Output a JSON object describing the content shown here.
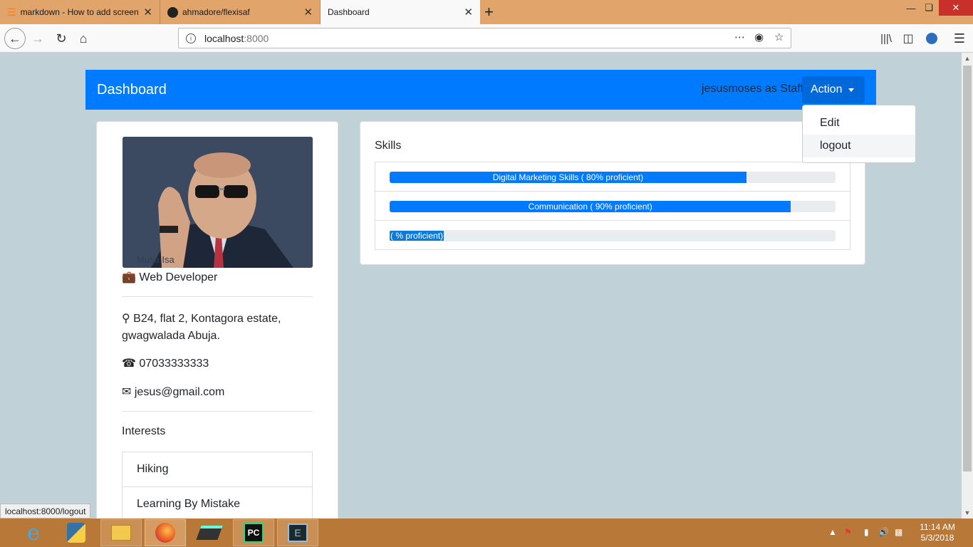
{
  "browser": {
    "tabs": [
      {
        "title": "markdown - How to add screen",
        "icon": "stackoverflow-icon"
      },
      {
        "title": "ahmadore/flexisaf",
        "icon": "github-icon"
      },
      {
        "title": "Dashboard",
        "icon": "",
        "active": true
      }
    ],
    "url_host": "localhost",
    "url_port": ":8000",
    "status_url": "localhost:8000/logout"
  },
  "navbar": {
    "brand": "Dashboard",
    "user_label": "jesusmoses as Staff",
    "action_label": "Action",
    "menu": [
      "Edit",
      "logout"
    ]
  },
  "profile": {
    "photo_caption": "Musa Isa",
    "job": "Web Developer",
    "address": "B24, flat 2, Kontagora estate, gwagwalada Abuja.",
    "phone": "07033333333",
    "email": "jesus@gmail.com",
    "interests_title": "Interests",
    "interests": [
      "Hiking",
      "Learning By Mistake"
    ]
  },
  "skills": {
    "title": "Skills",
    "items": [
      {
        "label": "Digital Marketing Skills ( 80% proficient)",
        "percent": 80
      },
      {
        "label": "Communication ( 90% proficient)",
        "percent": 90
      },
      {
        "label": "( % proficient)",
        "percent": 0
      }
    ]
  },
  "taskbar": {
    "apps": [
      "internet-explorer-icon",
      "python-icon",
      "file-explorer-icon",
      "firefox-icon",
      "scanner-icon",
      "pycharm-icon",
      "terminal-icon"
    ],
    "time": "11:14 AM",
    "date": "5/3/2018"
  },
  "colors": {
    "primary": "#007bff",
    "page_bg": "#c0d2d8",
    "tabbar": "#e1a46a",
    "taskbar": "#b87838"
  }
}
